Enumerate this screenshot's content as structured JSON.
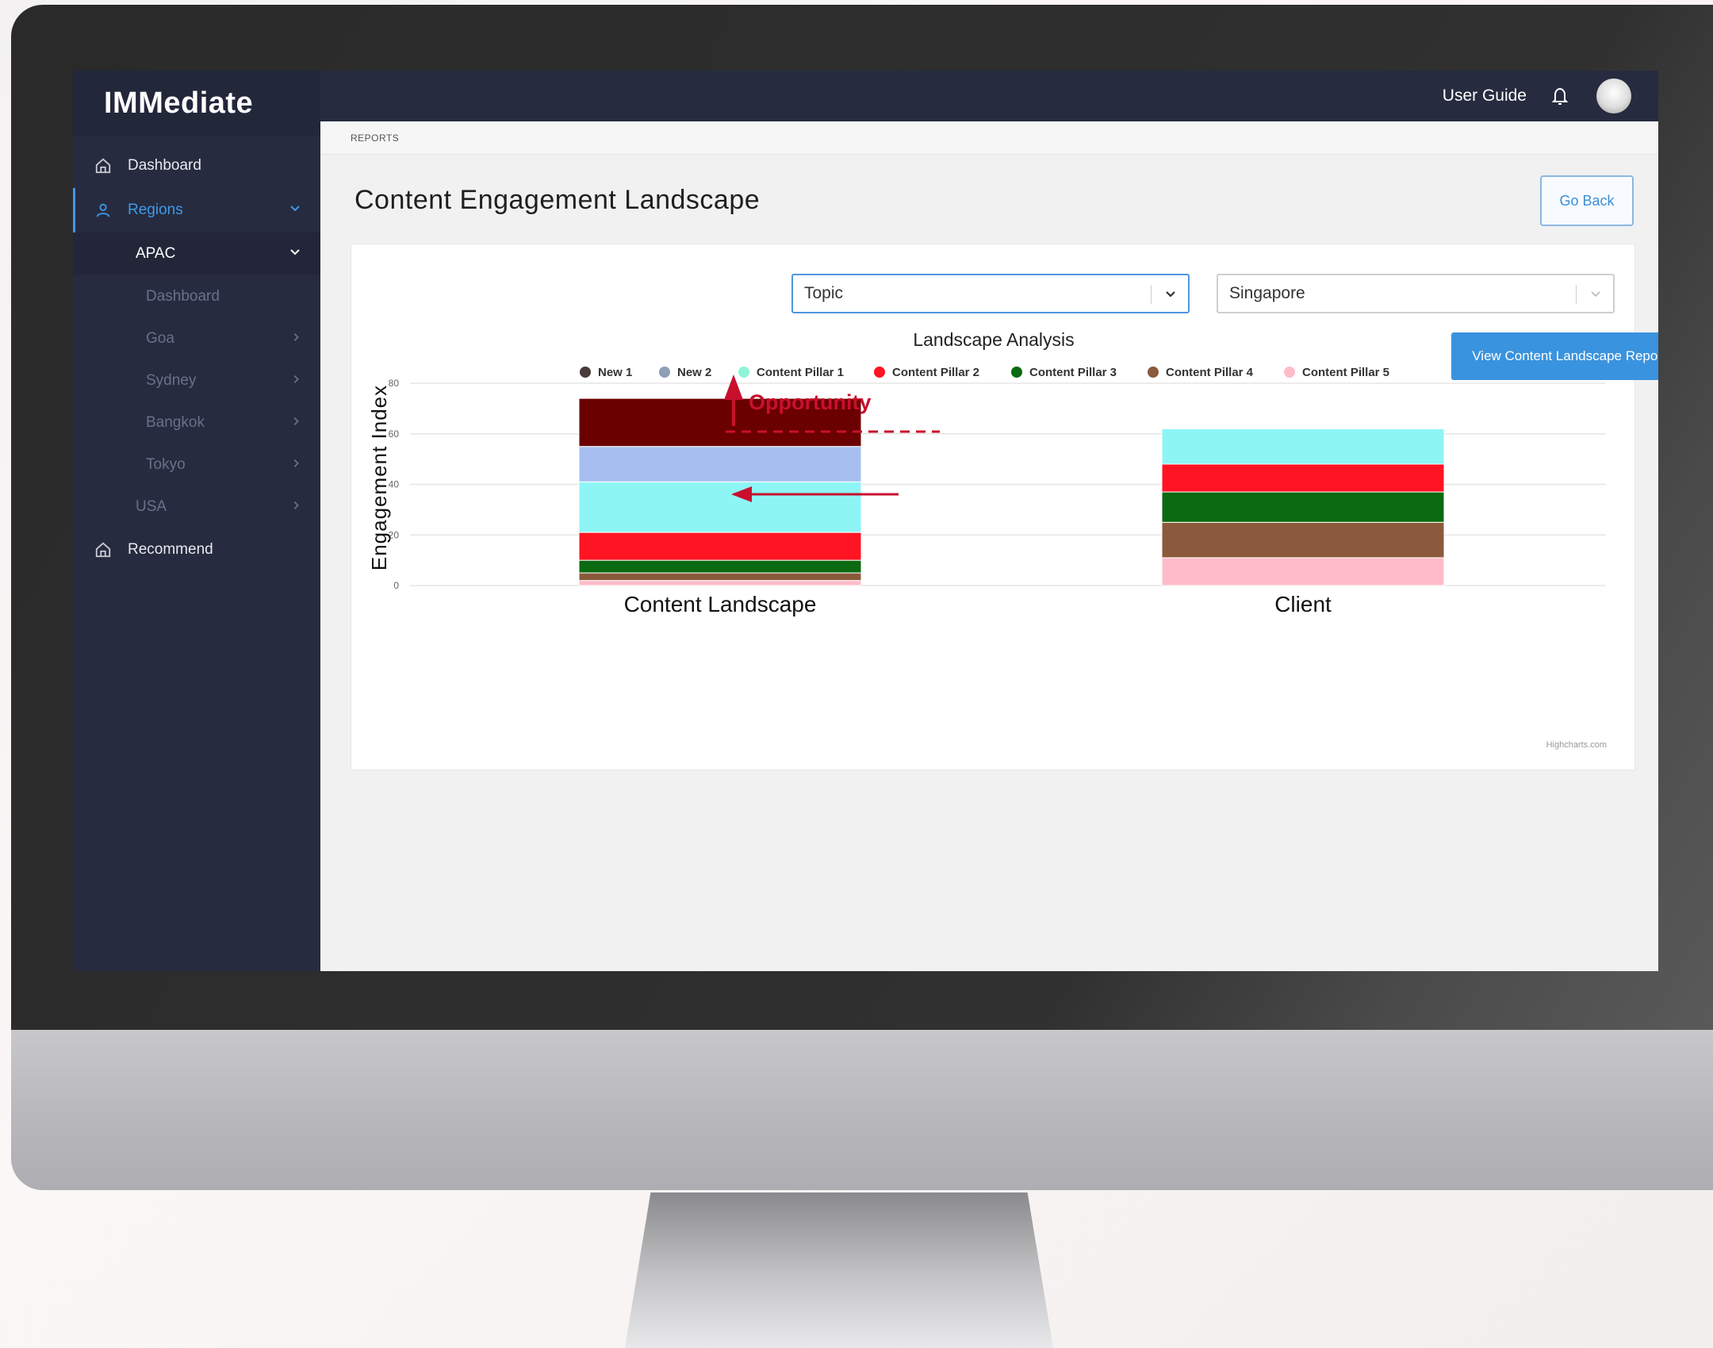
{
  "brand": "IMMediate",
  "sidebar": {
    "dashboard": "Dashboard",
    "regions": "Regions",
    "apac": "APAC",
    "apac_items": [
      "Dashboard",
      "Goa",
      "Sydney",
      "Bangkok",
      "Tokyo"
    ],
    "usa": "USA",
    "recommend": "Recommend"
  },
  "topbar": {
    "user_guide": "User Guide"
  },
  "breadcrumb": "REPORTS",
  "page_title": "Content Engagement Landscape",
  "go_back": "Go Back",
  "filters": {
    "topic": "Topic",
    "location": "Singapore"
  },
  "report_button": "View Content Landscape Report",
  "annotation": "Opportunity",
  "credit": "Highcharts.com",
  "colors": {
    "accent": "#3a93de",
    "sidebar_bg": "#262b3f",
    "annotation": "#c8102e"
  },
  "chart_data": {
    "type": "bar",
    "stacked": true,
    "title": "Landscape Analysis",
    "ylabel": "Engagement Index",
    "ylim": [
      0,
      80
    ],
    "yticks": [
      0,
      20,
      40,
      60,
      80
    ],
    "categories": [
      "Content Landscape",
      "Client"
    ],
    "legend_position": "top",
    "series": [
      {
        "name": "Content Pillar 5",
        "color": "#ffbcc8",
        "values": [
          2,
          11
        ]
      },
      {
        "name": "Content Pillar 4",
        "color": "#8b5a3c",
        "values": [
          3,
          14
        ]
      },
      {
        "name": "Content Pillar 3",
        "color": "#0b6a12",
        "values": [
          5,
          12
        ]
      },
      {
        "name": "Content Pillar 2",
        "color": "#ff1423",
        "values": [
          11,
          11
        ]
      },
      {
        "name": "Content Pillar 1",
        "color": "#8ef5f5",
        "values": [
          20,
          14
        ]
      },
      {
        "name": "New 2",
        "color": "#a7bff0",
        "values": [
          14,
          0
        ]
      },
      {
        "name": "New 1",
        "color": "#6b0000",
        "values": [
          19,
          0
        ]
      }
    ],
    "legend": [
      {
        "name": "New 1",
        "color": "#4a3a3a"
      },
      {
        "name": "New 2",
        "color": "#8f9fb6"
      },
      {
        "name": "Content Pillar 1",
        "color": "#8ef5d8"
      },
      {
        "name": "Content Pillar 2",
        "color": "#ff1423"
      },
      {
        "name": "Content Pillar 3",
        "color": "#0b6a12"
      },
      {
        "name": "Content Pillar 4",
        "color": "#8b5a3c"
      },
      {
        "name": "Content Pillar 5",
        "color": "#ffbcc8"
      }
    ]
  }
}
